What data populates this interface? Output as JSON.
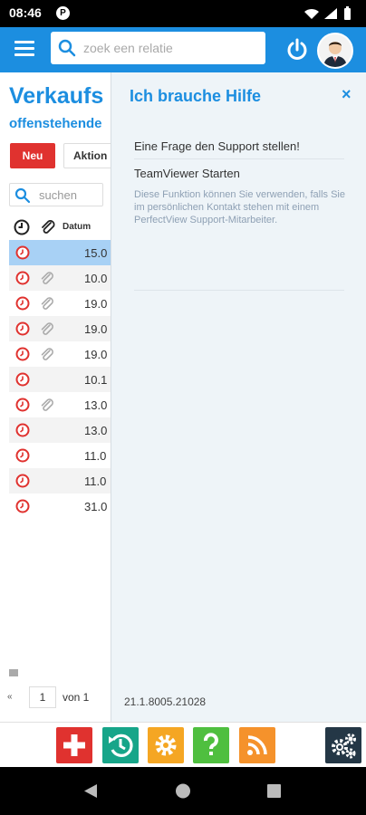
{
  "status_bar": {
    "time": "08:46",
    "app_icon": "P"
  },
  "header": {
    "menu_icon": "hamburger-icon",
    "search_placeholder": "zoek een relatie",
    "power_icon": "power-icon",
    "avatar": "user-avatar"
  },
  "left_panel": {
    "title": "Verkaufs",
    "subtitle": "offenstehende",
    "new_button": "Neu",
    "action_button": "Aktion",
    "search_placeholder": "suchen",
    "columns": {
      "date": "Datum"
    },
    "rows": [
      {
        "date": "15.0",
        "attachment": false
      },
      {
        "date": "10.0",
        "attachment": true
      },
      {
        "date": "19.0",
        "attachment": true
      },
      {
        "date": "19.0",
        "attachment": true
      },
      {
        "date": "19.0",
        "attachment": true
      },
      {
        "date": "10.1",
        "attachment": false
      },
      {
        "date": "13.0",
        "attachment": true
      },
      {
        "date": "13.0",
        "attachment": false
      },
      {
        "date": "11.0",
        "attachment": false
      },
      {
        "date": "11.0",
        "attachment": false
      },
      {
        "date": "31.0",
        "attachment": false
      }
    ],
    "pager": {
      "prev": "«",
      "page": "1",
      "of": "von 1"
    }
  },
  "help_panel": {
    "title": "Ich brauche Hilfe",
    "close": "×",
    "items": [
      "Eine Frage den Support stellen!",
      "TeamViewer Starten"
    ],
    "description": "Diese Funktion können Sie verwenden, falls Sie im persönlichen Kontakt stehen mit einem PerfectView Support-Mitarbeiter.",
    "version": "21.1.8005.21028"
  },
  "toolbar": {
    "buttons": [
      "add-icon",
      "history-icon",
      "settings-icon",
      "help-icon",
      "rss-icon",
      "gears-icon"
    ]
  },
  "colors": {
    "primary": "#1c8ee0",
    "danger": "#e0322f",
    "teal": "#17a589",
    "orange": "#f5a623",
    "green": "#4fbf3f",
    "rss": "#f5922b",
    "dark": "#243746"
  }
}
